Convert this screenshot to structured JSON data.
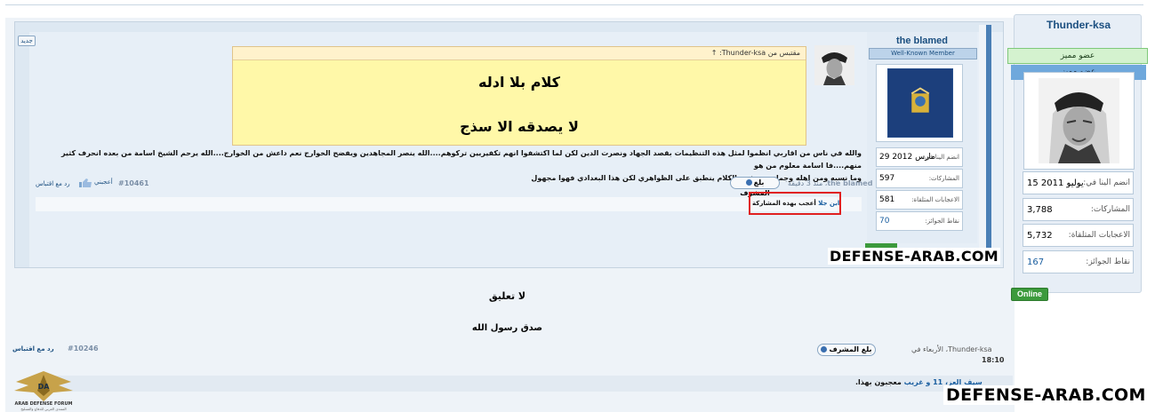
{
  "outer_post": {
    "username": "Thunder-ksa",
    "title1": "عضو مميز",
    "title2": "عضو مميز",
    "stats": [
      {
        "label": "انضم الينا في:",
        "value": "15 يوليو 2011"
      },
      {
        "label": "المشاركات:",
        "value": "3,788"
      },
      {
        "label": "الاعجابات المتلقاة:",
        "value": "5,732"
      },
      {
        "label": "نقاط الجوائز:",
        "value": "167"
      }
    ],
    "online": "Online",
    "body_line1": "لا تعليق",
    "body_line2": "صدق رسول الله",
    "meta_author": "Thunder-ksa",
    "meta_date": "، الأربعاء في",
    "meta_time": "18:10",
    "report": "بلغ المشرف",
    "post_number": "#10246",
    "reply_quote": "رد مع اقتباس",
    "likes_prefix": "",
    "likes_users": "سيف العز، 11 و غريب",
    "likes_suffix": "معجبون بهذا."
  },
  "inner_post": {
    "new_label": "جديد",
    "username": "the blamed",
    "rank": "Well-Known Member",
    "stats": [
      {
        "label": "انضم الينا في:",
        "value": "29 مارس 2012"
      },
      {
        "label": "المشاركات:",
        "value": "597"
      },
      {
        "label": "الاعجابات المتلقاة:",
        "value": "581"
      },
      {
        "label": "نقاط الجوائز:",
        "value": "70"
      }
    ],
    "quote_header": "مقتبس من Thunder-ksa: ↑",
    "quote_line1": "كلام بلا ادله",
    "quote_line2": "لا يصدقه الا سذج",
    "text_line1": "والله في ناس من اقاربي انظموا لمثل هذه التنظيمات بقصد الجهاد ونصرت الدين لكن لما اكتشفوا انهم تكفيريين تركوهم....الله ينصر المجاهدين ويفضح الخوارج نعم داعش من الخوارج....الله يرحم الشيخ اسامة من بعده انحرف كثير منهم....فا اسامة معلوم من هو",
    "text_line2": "وما نسبه ومن اهله وجماعته ونفس الكلام ينطبق على الظواهري لكن هذا البغدادي فهوا مجهول",
    "report": "بلغ المشرف",
    "meta_author": "the blamed",
    "meta_time": "، منذ 3 دقيقة",
    "post_number": "#10461",
    "like_label": "أعجبني",
    "reply_quote": "رد مع اقتباس",
    "like_text_prefix": "أعجب بهذه المشاركة",
    "like_text_user": "ابن جلا"
  },
  "watermarks": [
    "DEFENSE-ARAB.COM",
    "DEFENSE-ARAB.COM"
  ],
  "logo": {
    "line1": "ARAB DEFENSE FORUM",
    "line2": "المنتدى العربي للدفاع والتسليح",
    "mark": "DA"
  }
}
